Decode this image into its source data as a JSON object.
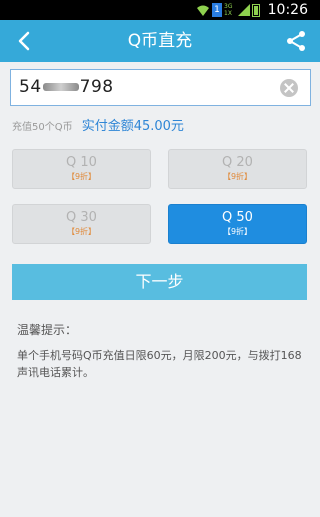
{
  "statusbar": {
    "time": "10:26",
    "sim_label": "1",
    "net_top": "3G",
    "net_bottom": "1X"
  },
  "titlebar": {
    "title": "Q币直充",
    "back_icon": "back-arrow-icon",
    "share_icon": "share-icon"
  },
  "phone_input": {
    "value_prefix": "54",
    "value_suffix": "798"
  },
  "info": {
    "recharge_text": "充值50个Q币",
    "pay_text": "实付金额45.00元"
  },
  "options": [
    {
      "label": "Q 10",
      "discount": "【9折】"
    },
    {
      "label": "Q 20",
      "discount": "【9折】"
    },
    {
      "label": "Q 30",
      "discount": "【9折】"
    },
    {
      "label": "Q 50",
      "discount": "【9折】"
    }
  ],
  "next_button": "下一步",
  "tips": {
    "title": "温馨提示：",
    "body": "单个手机号码Q币充值日限60元，月限200元，与拨打168声讯电话累计。"
  },
  "colors": {
    "title_bar": "#35a9d9",
    "selected": "#1f8de0",
    "next_button": "#58bde0",
    "discount": "#e08a3a"
  }
}
